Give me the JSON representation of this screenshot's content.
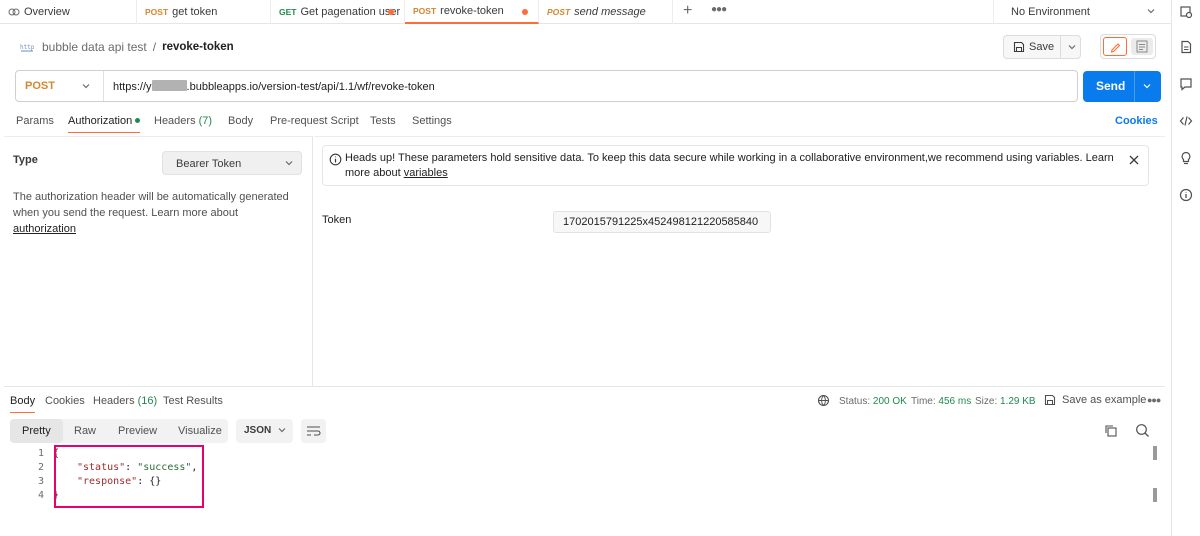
{
  "tabs": {
    "overview_label": "Overview",
    "items": [
      {
        "method": "POST",
        "label": "get token"
      },
      {
        "method": "GET",
        "label": "Get pagenation user"
      },
      {
        "method": "POST",
        "label": "revoke-token"
      },
      {
        "method": "POST",
        "label": "send message"
      }
    ],
    "environment": "No Environment"
  },
  "breadcrumb": {
    "collection": "bubble data api test",
    "separator": "/",
    "current": "revoke-token"
  },
  "toolbar": {
    "save_label": "Save"
  },
  "request": {
    "method": "POST",
    "url_prefix": "https://y",
    "url_suffix": ".bubbleapps.io/version-test/api/1.1/wf/revoke-token",
    "send_label": "Send"
  },
  "request_tabs": {
    "params": "Params",
    "authorization": "Authorization",
    "headers": "Headers",
    "headers_count": "(7)",
    "body": "Body",
    "prerequest": "Pre-request Script",
    "tests": "Tests",
    "settings": "Settings",
    "cookies": "Cookies"
  },
  "auth": {
    "type_label": "Type",
    "type_value": "Bearer Token",
    "description": "The authorization header will be automatically generated when you send the request. Learn more about ",
    "description_link": "authorization",
    "banner_text": "Heads up! These parameters hold sensitive data. To keep this data secure while working in a collaborative environment,we recommend using variables. Learn more about ",
    "banner_link": "variables",
    "token_label": "Token",
    "token_value": "1702015791225x452498121220585840"
  },
  "response": {
    "tabs": {
      "body": "Body",
      "cookies": "Cookies",
      "headers": "Headers",
      "headers_count": "(16)",
      "test_results": "Test Results"
    },
    "status_label": "Status:",
    "status_value": "200 OK",
    "time_label": "Time:",
    "time_value": "456 ms",
    "size_label": "Size:",
    "size_value": "1.29 KB",
    "save_example": "Save as example",
    "formats": [
      "Pretty",
      "Raw",
      "Preview",
      "Visualize"
    ],
    "format_selected": "JSON",
    "lines": [
      "1",
      "2",
      "3",
      "4"
    ],
    "code": {
      "open": "{",
      "key1": "\"status\"",
      "val1": "\"success\"",
      "key2": "\"response\"",
      "val2": "{}",
      "close": "}"
    }
  }
}
